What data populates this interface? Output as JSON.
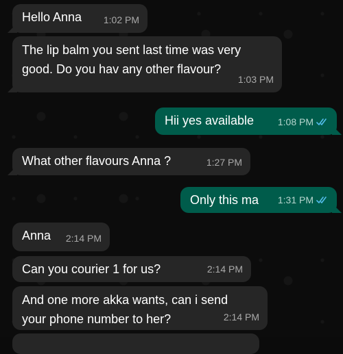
{
  "messages": [
    {
      "direction": "in",
      "text": "Hello Anna",
      "time": "1:02 PM"
    },
    {
      "direction": "in",
      "text_lines": [
        "The lip balm you sent last time was very",
        "good. Do you hav any other flavour?"
      ],
      "time": "1:03 PM"
    },
    {
      "direction": "out",
      "text": "Hii yes available",
      "time": "1:08 PM",
      "status": "read"
    },
    {
      "direction": "in",
      "text": "What other flavours Anna ?",
      "time": "1:27 PM"
    },
    {
      "direction": "out",
      "text": "Only this ma",
      "time": "1:31 PM",
      "status": "read"
    },
    {
      "direction": "in",
      "text": "Anna",
      "time": "2:14 PM"
    },
    {
      "direction": "in",
      "text": "Can you courier 1 for us?",
      "time": "2:14 PM"
    },
    {
      "direction": "in",
      "text_lines": [
        "And one more akka wants, can i send",
        "your phone number to her?"
      ],
      "time": "2:14 PM"
    }
  ],
  "colors": {
    "incoming_bubble": "#262626",
    "outgoing_bubble": "#005c4b",
    "read_ticks": "#53bdeb"
  },
  "icons": {
    "read_receipt": "double-check-icon"
  }
}
